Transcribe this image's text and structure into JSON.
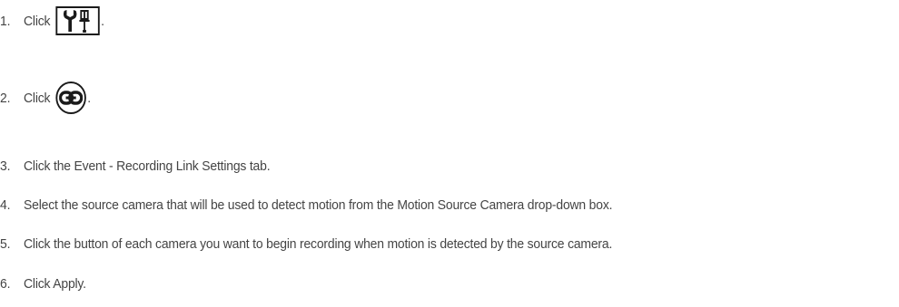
{
  "steps": [
    {
      "number": "1.",
      "text": "Click",
      "suffix": ".",
      "icon": "tools-icon"
    },
    {
      "number": "2.",
      "text": "Click",
      "suffix": ".",
      "icon": "link-chain-icon"
    },
    {
      "number": "3.",
      "text": "Click the Event - Recording Link Settings tab."
    },
    {
      "number": "4.",
      "text": "Select the source camera that will be used to detect motion from the Motion Source Camera drop-down box."
    },
    {
      "number": "5.",
      "text": "Click the button of each camera you want to begin recording when motion is detected by the source camera."
    },
    {
      "number": "6.",
      "text": "Click Apply."
    }
  ],
  "colors": {
    "text": "#444444",
    "icon": "#1a1a1a"
  }
}
